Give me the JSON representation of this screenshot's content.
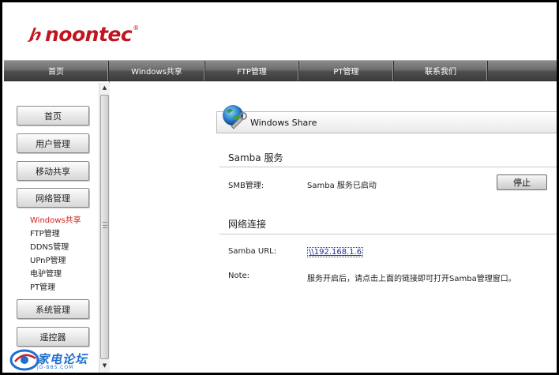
{
  "logo": {
    "text": "noontec",
    "reg": "®"
  },
  "colors": {
    "brand": "#c0141f",
    "active": "#d0211c",
    "link": "#1a2aa8",
    "nav_bg": "#5a5a5a"
  },
  "topnav": [
    {
      "label": "首页"
    },
    {
      "label": "Windows共享"
    },
    {
      "label": "FTP管理"
    },
    {
      "label": "PT管理"
    },
    {
      "label": "联系我们"
    },
    {
      "label": ""
    }
  ],
  "sidebar": {
    "buttons": {
      "home": "首页",
      "user": "用户管理",
      "mobile": "移动共享",
      "network": "网络管理",
      "system": "系统管理",
      "remote": "遥控器"
    },
    "sub": [
      "Windows共享",
      "FTP管理",
      "DDNS管理",
      "UPnP管理",
      "电驴管理",
      "PT管理"
    ],
    "active_sub": "Windows共享"
  },
  "panel": {
    "title": "Windows Share",
    "icon": "globe-wrench-icon",
    "samba_section": "Samba 服务",
    "smb_label": "SMB管理:",
    "smb_status": "Samba 服务已启动",
    "stop_label": "停止",
    "network_section": "网络连接",
    "url_label": "Samba URL:",
    "url_value": "\\\\192.168.1.6",
    "note_label": "Note:",
    "note_text": "服务开启后，请点击上面的链接即可打开Samba管理窗口。"
  },
  "watermark": {
    "text": "家电论坛",
    "sub": "JD-BBS.COM"
  }
}
